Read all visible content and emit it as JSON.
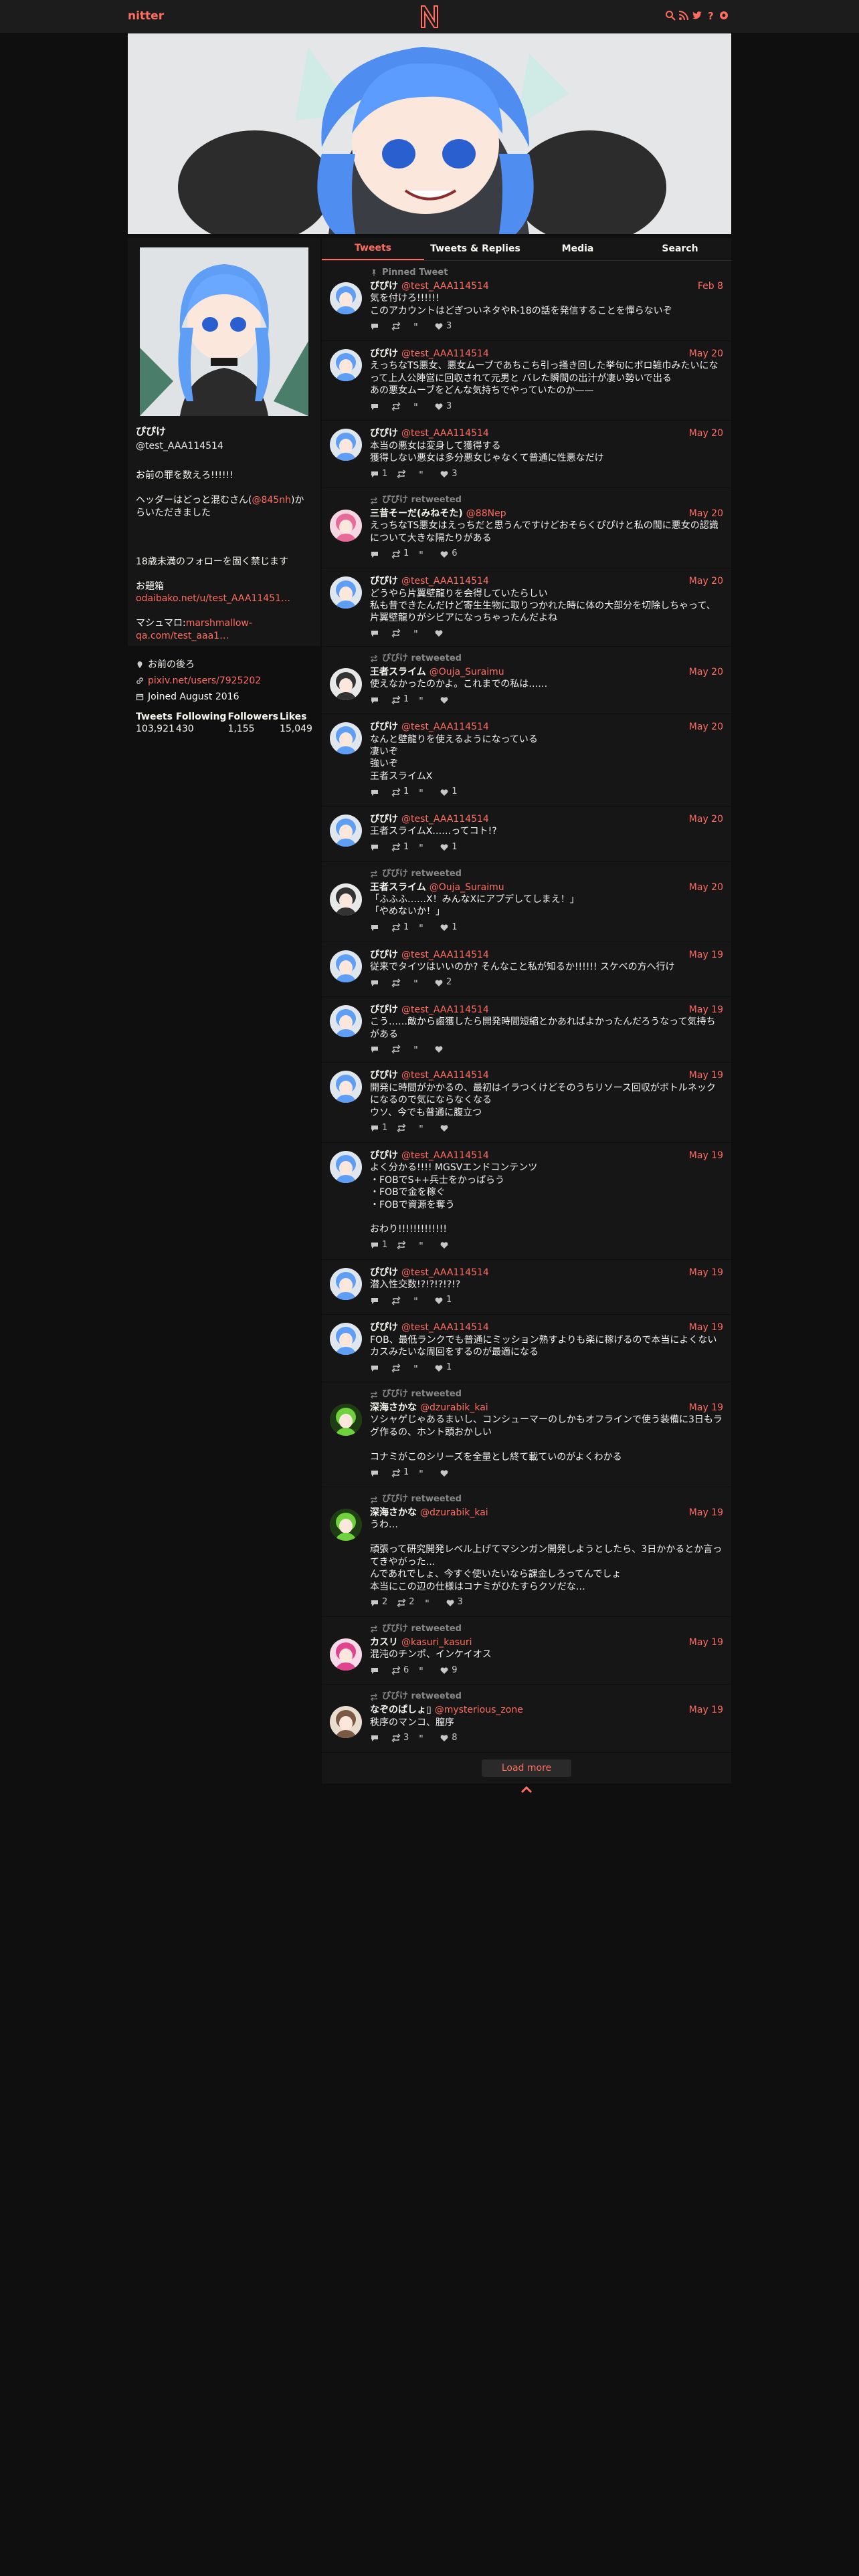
{
  "nav": {
    "brand": "nitter",
    "icons": [
      "search-icon",
      "rss-icon",
      "twitter-icon",
      "help-icon",
      "settings-icon"
    ]
  },
  "colors": {
    "accent": "#ff6c60",
    "background": "#0f0f0f",
    "panel": "#161616"
  },
  "profile": {
    "name": "ぴぴけ",
    "handle": "@test_AAA114514",
    "bio_line1": "お前の罪を数えろ!!!!!!",
    "bio_line2a": "ヘッダーはどっと混むさん(",
    "bio_link1": "@845nh",
    "bio_line2b": ")からいただきました",
    "bio_line3": "18歳未満のフォローを固く禁じます",
    "bio_line4a": "お題箱",
    "bio_link2": "odaibako.net/u/test_AAA11451…",
    "bio_line5a": "マシュマロ:",
    "bio_link3": "marshmallow-qa.com/test_aaa1…",
    "location": "お前の後ろ",
    "website": "pixiv.net/users/7925202",
    "joined": "Joined August 2016",
    "stats": {
      "tweets_label": "Tweets",
      "tweets": "103,921",
      "following_label": "Following",
      "following": "430",
      "followers_label": "Followers",
      "followers": "1,155",
      "likes_label": "Likes",
      "likes": "15,049"
    }
  },
  "tabs": [
    "Tweets",
    "Tweets & Replies",
    "Media",
    "Search"
  ],
  "tweets": [
    {
      "context": "Pinned Tweet",
      "name": "ぴぴけ",
      "username": "@test_AAA114514",
      "date": "Feb 8",
      "body": "気を付けろ!!!!!!\nこのアカウントはどぎついネタやR-18の話を発信することを憚らないぞ",
      "replies": "",
      "retweets": "",
      "quotes": "",
      "likes": "3"
    },
    {
      "context": "",
      "name": "ぴぴけ",
      "username": "@test_AAA114514",
      "date": "May 20",
      "body": "えっちなTS悪女、悪女ムーブであちこち引っ掻き回した挙句にボロ雑巾みたいになって上人公陣営に回収されて元男と バレた瞬間の出汁が凄い勢いで出る\nあの悪女ムーブをどんな気持ちでやっていたのか——",
      "replies": "",
      "retweets": "",
      "quotes": "",
      "likes": "3"
    },
    {
      "context": "",
      "name": "ぴぴけ",
      "username": "@test_AAA114514",
      "date": "May 20",
      "body": "本当の悪女は変身して獲得する\n獲得しない悪女は多分悪女じゃなくて普通に性悪なだけ",
      "replies": "1",
      "retweets": "",
      "quotes": "",
      "likes": "3"
    },
    {
      "context": "ぴぴけ retweeted",
      "name": "三昔そーだ(みねそた)",
      "username": "@88Nep",
      "date": "May 20",
      "body": "えっちなTS悪女はえっちだと思うんですけどおそらくぴぴけと私の間に悪女の認識について大きな隔たりがある",
      "replies": "",
      "retweets": "1",
      "quotes": "",
      "likes": "6"
    },
    {
      "context": "",
      "name": "ぴぴけ",
      "username": "@test_AAA114514",
      "date": "May 20",
      "body": "どうやら片翼壁龍りを会得していたらしい\n私も昔できたんだけど寄生生物に取りつかれた時に体の大部分を切除しちゃって、片翼壁龍りがシビアになっちゃったんだよね",
      "replies": "",
      "retweets": "",
      "quotes": "",
      "likes": ""
    },
    {
      "context": "ぴぴけ retweeted",
      "name": "王者スライム",
      "username": "@Ouja_Suraimu",
      "date": "May 20",
      "body": "使えなかったのかよ。これまでの私は……",
      "replies": "",
      "retweets": "1",
      "quotes": "",
      "likes": ""
    },
    {
      "context": "",
      "name": "ぴぴけ",
      "username": "@test_AAA114514",
      "date": "May 20",
      "body": "なんと壁龍りを使えるようになっている\n凄いぞ\n強いぞ\n王者スライムX",
      "replies": "",
      "retweets": "1",
      "quotes": "",
      "likes": "1"
    },
    {
      "context": "",
      "name": "ぴぴけ",
      "username": "@test_AAA114514",
      "date": "May 20",
      "body": "王者スライムX……ってコト!?",
      "replies": "",
      "retweets": "1",
      "quotes": "",
      "likes": "1"
    },
    {
      "context": "ぴぴけ retweeted",
      "name": "王者スライム",
      "username": "@Ouja_Suraimu",
      "date": "May 20",
      "body": "「ふふふ……X！みんなXにアプデしてしまえ！」\n「やめないか！」",
      "replies": "",
      "retweets": "1",
      "quotes": "",
      "likes": "1"
    },
    {
      "context": "",
      "name": "ぴぴけ",
      "username": "@test_AAA114514",
      "date": "May 19",
      "body": "従来でタイツはいいのか? そんなこと私が知るか!!!!!! スケベの方へ行け",
      "replies": "",
      "retweets": "",
      "quotes": "",
      "likes": "2"
    },
    {
      "context": "",
      "name": "ぴぴけ",
      "username": "@test_AAA114514",
      "date": "May 19",
      "body": "こう……敵から鹵獲したら開発時間短縮とかあればよかったんだろうなって気持ちがある",
      "replies": "",
      "retweets": "",
      "quotes": "",
      "likes": ""
    },
    {
      "context": "",
      "name": "ぴぴけ",
      "username": "@test_AAA114514",
      "date": "May 19",
      "body": "開発に時間がかかるの、最初はイラつくけどそのうちリソース回収がボトルネックになるので気にならなくなる\nウソ、今でも普通に腹立つ",
      "replies": "1",
      "retweets": "",
      "quotes": "",
      "likes": ""
    },
    {
      "context": "",
      "name": "ぴぴけ",
      "username": "@test_AAA114514",
      "date": "May 19",
      "body": "よく分かる!!!! MGSVエンドコンテンツ\n・FOBでS++兵士をかっぱらう\n・FOBで金を稼ぐ\n・FOBで資源を奪う\n\nおわり!!!!!!!!!!!!!",
      "replies": "1",
      "retweets": "",
      "quotes": "",
      "likes": ""
    },
    {
      "context": "",
      "name": "ぴぴけ",
      "username": "@test_AAA114514",
      "date": "May 19",
      "body": "潜入性交数!?!?!?!?!?",
      "replies": "",
      "retweets": "",
      "quotes": "",
      "likes": "1"
    },
    {
      "context": "",
      "name": "ぴぴけ",
      "username": "@test_AAA114514",
      "date": "May 19",
      "body": "FOB、最低ランクでも普通にミッション熟すよりも楽に稼げるので本当によくないカスみたいな周回をするのが最適になる",
      "replies": "",
      "retweets": "",
      "quotes": "",
      "likes": "1"
    },
    {
      "context": "ぴぴけ retweeted",
      "name": "深海さかな",
      "username": "@dzurabik_kai",
      "date": "May 19",
      "body": "ソシャゲじゃあるまいし、コンシューマーのしかもオフラインで使う装備に3日もラグ作るの、ホント頭おかしい\n\nコナミがこのシリーズを全量とし終て載ていのがよくわかる",
      "replies": "",
      "retweets": "1",
      "quotes": "",
      "likes": ""
    },
    {
      "context": "ぴぴけ retweeted",
      "name": "深海さかな",
      "username": "@dzurabik_kai",
      "date": "May 19",
      "body": "うわ…\n\n頑張って研究開発レベル上げてマシンガン開発しようとしたら、3日かかるとか言ってきやがった…\nんであれでしょ、今すぐ使いたいなら課金しろってんでしょ\n本当にこの辺の仕様はコナミがひたすらクソだな…",
      "replies": "2",
      "retweets": "2",
      "quotes": "",
      "likes": "3"
    },
    {
      "context": "ぴぴけ retweeted",
      "name": "カスリ",
      "username": "@kasuri_kasuri",
      "date": "May 19",
      "body": "混沌のチンポ、インケイオス",
      "replies": "",
      "retweets": "6",
      "quotes": "",
      "likes": "9"
    },
    {
      "context": "ぴぴけ retweeted",
      "name": "なぞのぱしょ▯",
      "username": "@mysterious_zone",
      "date": "May 19",
      "body": "秩序のマンコ、膣序",
      "replies": "",
      "retweets": "3",
      "quotes": "",
      "likes": "8"
    }
  ],
  "load_more": "Load more"
}
